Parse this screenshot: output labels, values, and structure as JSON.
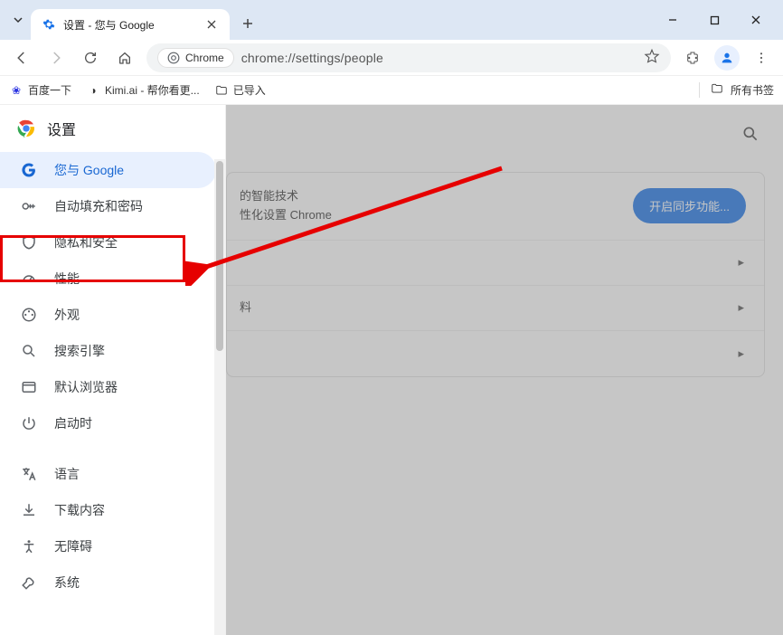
{
  "tab": {
    "title": "设置 - 您与 Google"
  },
  "toolbar": {
    "chrome_chip": "Chrome",
    "url": "chrome://settings/people"
  },
  "bookmarks": {
    "items": [
      {
        "label": "百度一下"
      },
      {
        "label": "Kimi.ai - 帮你看更..."
      },
      {
        "label": "已导入"
      }
    ],
    "right": "所有书签"
  },
  "sidebar": {
    "title": "设置",
    "items": [
      {
        "label": "您与 Google",
        "active": true
      },
      {
        "label": "自动填充和密码"
      },
      {
        "label": "隐私和安全"
      },
      {
        "label": "性能"
      },
      {
        "label": "外观"
      },
      {
        "label": "搜索引擎"
      },
      {
        "label": "默认浏览器"
      },
      {
        "label": "启动时"
      }
    ],
    "items2": [
      {
        "label": "语言"
      },
      {
        "label": "下载内容"
      },
      {
        "label": "无障碍"
      },
      {
        "label": "系统"
      }
    ]
  },
  "content": {
    "row0_line1": "的智能技术",
    "row0_line2": "性化设置 Chrome",
    "sync_btn": "开启同步功能...",
    "row2": "料"
  }
}
